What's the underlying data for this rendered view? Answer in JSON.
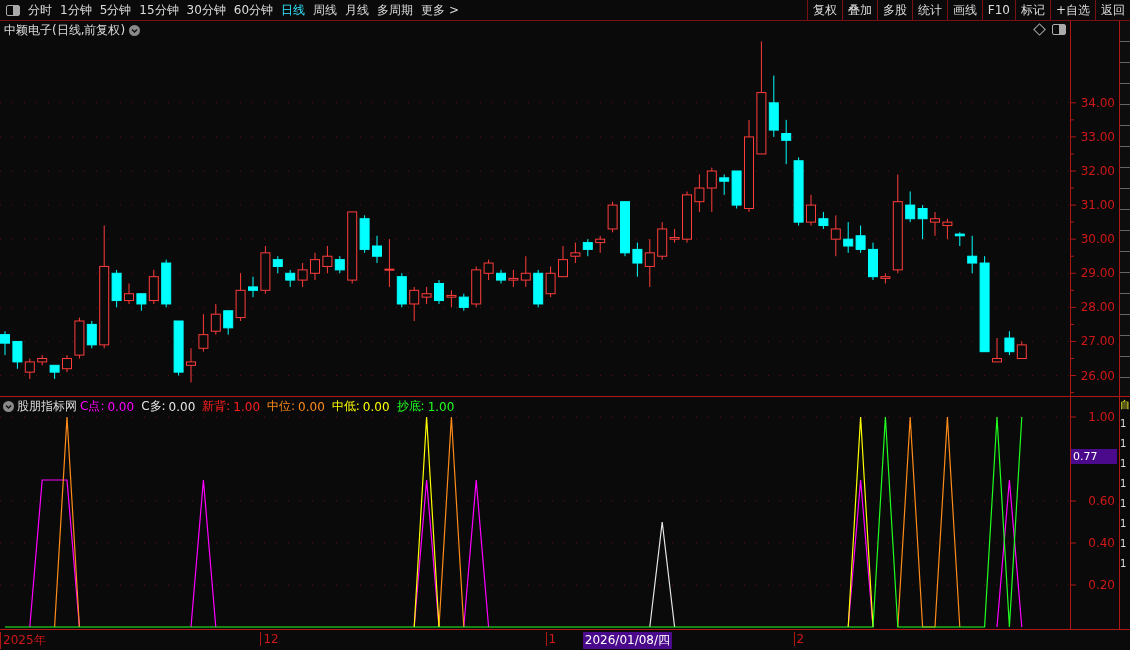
{
  "toolbar": {
    "periods": [
      {
        "label": "分时",
        "selected": false
      },
      {
        "label": "1分钟",
        "selected": false
      },
      {
        "label": "5分钟",
        "selected": false
      },
      {
        "label": "15分钟",
        "selected": false
      },
      {
        "label": "30分钟",
        "selected": false
      },
      {
        "label": "60分钟",
        "selected": false
      },
      {
        "label": "日线",
        "selected": true
      },
      {
        "label": "周线",
        "selected": false
      },
      {
        "label": "月线",
        "selected": false
      },
      {
        "label": "多周期",
        "selected": false
      },
      {
        "label": "更多 >",
        "selected": false
      }
    ],
    "buttons": [
      "复权",
      "叠加",
      "多股",
      "统计",
      "画线",
      "F10",
      "标记",
      "+自选",
      "返回"
    ]
  },
  "price_pane": {
    "title": "中颖电子(日线,前复权)",
    "chart_data": {
      "type": "candlestick",
      "ylim": [
        25.4,
        36.4
      ],
      "grid": true,
      "yticks": [
        {
          "value": 34,
          "label": "34.00"
        },
        {
          "value": 33,
          "label": "33.00"
        },
        {
          "value": 32,
          "label": "32.00"
        },
        {
          "value": 31,
          "label": "31.00"
        },
        {
          "value": 30,
          "label": "30.00"
        },
        {
          "value": 29,
          "label": "29.00"
        },
        {
          "value": 28,
          "label": "28.00"
        },
        {
          "value": 27,
          "label": "27.00"
        },
        {
          "value": 26,
          "label": "26.00"
        }
      ],
      "ohlc": [
        [
          27.2,
          27.3,
          26.6,
          26.95
        ],
        [
          27.0,
          27.0,
          26.2,
          26.4
        ],
        [
          26.1,
          26.5,
          25.9,
          26.4
        ],
        [
          26.4,
          26.6,
          26.3,
          26.5
        ],
        [
          26.3,
          26.3,
          25.9,
          26.1
        ],
        [
          26.2,
          26.6,
          26.1,
          26.5
        ],
        [
          26.6,
          27.7,
          26.5,
          27.6
        ],
        [
          27.5,
          27.6,
          26.8,
          26.9
        ],
        [
          26.9,
          30.4,
          26.8,
          29.2
        ],
        [
          29.0,
          29.1,
          28.0,
          28.2
        ],
        [
          28.2,
          28.7,
          28.1,
          28.4
        ],
        [
          28.4,
          28.4,
          27.9,
          28.1
        ],
        [
          28.2,
          29.1,
          28.1,
          28.9
        ],
        [
          29.3,
          29.4,
          28.0,
          28.1
        ],
        [
          27.6,
          27.6,
          26.0,
          26.1
        ],
        [
          26.3,
          26.8,
          25.8,
          26.4
        ],
        [
          26.8,
          27.8,
          26.7,
          27.2
        ],
        [
          27.3,
          28.1,
          27.2,
          27.8
        ],
        [
          27.9,
          27.9,
          27.2,
          27.4
        ],
        [
          27.7,
          29.0,
          27.6,
          28.5
        ],
        [
          28.6,
          28.9,
          28.3,
          28.5
        ],
        [
          28.5,
          29.8,
          28.4,
          29.6
        ],
        [
          29.4,
          29.5,
          29.0,
          29.2
        ],
        [
          29.0,
          29.1,
          28.6,
          28.8
        ],
        [
          28.8,
          29.3,
          28.6,
          29.1
        ],
        [
          29.0,
          29.6,
          28.8,
          29.4
        ],
        [
          29.2,
          29.8,
          29.0,
          29.5
        ],
        [
          29.4,
          29.5,
          29.0,
          29.1
        ],
        [
          28.8,
          30.8,
          28.7,
          30.8
        ],
        [
          30.6,
          30.7,
          29.6,
          29.7
        ],
        [
          29.8,
          30.1,
          29.3,
          29.5
        ],
        [
          29.1,
          30.0,
          28.6,
          29.12
        ],
        [
          28.9,
          29.0,
          28.0,
          28.1
        ],
        [
          28.1,
          28.6,
          27.6,
          28.5
        ],
        [
          28.3,
          28.6,
          28.1,
          28.4
        ],
        [
          28.7,
          28.8,
          28.1,
          28.2
        ],
        [
          28.3,
          28.5,
          28.0,
          28.35
        ],
        [
          28.3,
          28.4,
          27.9,
          28.0
        ],
        [
          28.1,
          29.2,
          28.0,
          29.1
        ],
        [
          29.0,
          29.4,
          28.8,
          29.3
        ],
        [
          29.0,
          29.1,
          28.7,
          28.8
        ],
        [
          28.8,
          29.1,
          28.6,
          28.85
        ],
        [
          28.8,
          29.5,
          28.6,
          29.0
        ],
        [
          29.0,
          29.1,
          28.0,
          28.1
        ],
        [
          28.4,
          29.2,
          28.3,
          29.0
        ],
        [
          28.9,
          29.8,
          28.9,
          29.4
        ],
        [
          29.5,
          29.9,
          29.3,
          29.6
        ],
        [
          29.9,
          30.0,
          29.5,
          29.7
        ],
        [
          29.9,
          30.1,
          29.6,
          30.0
        ],
        [
          30.3,
          31.1,
          30.2,
          31.0
        ],
        [
          31.1,
          31.1,
          29.5,
          29.6
        ],
        [
          29.7,
          29.9,
          28.9,
          29.3
        ],
        [
          29.2,
          30.0,
          28.6,
          29.6
        ],
        [
          29.5,
          30.5,
          29.4,
          30.3
        ],
        [
          30.0,
          30.3,
          29.9,
          30.05
        ],
        [
          30.0,
          31.4,
          29.9,
          31.3
        ],
        [
          31.1,
          31.9,
          30.8,
          31.5
        ],
        [
          31.5,
          32.1,
          30.8,
          32.0
        ],
        [
          31.8,
          31.9,
          31.3,
          31.7
        ],
        [
          32.0,
          32.0,
          30.9,
          31.0
        ],
        [
          30.9,
          33.5,
          30.8,
          33.0
        ],
        [
          32.5,
          35.8,
          32.5,
          34.3
        ],
        [
          34.0,
          34.8,
          33.0,
          33.2
        ],
        [
          33.1,
          33.5,
          32.2,
          32.9
        ],
        [
          32.3,
          32.4,
          30.4,
          30.5
        ],
        [
          30.5,
          31.3,
          30.4,
          31.0
        ],
        [
          30.6,
          30.8,
          30.3,
          30.4
        ],
        [
          30.0,
          30.7,
          29.5,
          30.3
        ],
        [
          30.0,
          30.5,
          29.6,
          29.8
        ],
        [
          30.1,
          30.4,
          29.6,
          29.7
        ],
        [
          29.7,
          29.9,
          28.8,
          28.9
        ],
        [
          28.85,
          29.0,
          28.7,
          28.9
        ],
        [
          29.1,
          31.9,
          29.0,
          31.1
        ],
        [
          31.0,
          31.4,
          30.5,
          30.6
        ],
        [
          30.9,
          31.0,
          30.0,
          30.6
        ],
        [
          30.5,
          30.8,
          30.1,
          30.6
        ],
        [
          30.4,
          30.6,
          30.0,
          30.5
        ],
        [
          30.15,
          30.2,
          29.8,
          30.1
        ],
        [
          29.5,
          30.1,
          29.0,
          29.3
        ],
        [
          29.3,
          29.5,
          26.7,
          26.7
        ],
        [
          26.4,
          27.1,
          26.4,
          26.5
        ],
        [
          27.1,
          27.3,
          26.6,
          26.7
        ],
        [
          26.5,
          27.0,
          26.5,
          26.9
        ]
      ]
    }
  },
  "indicator": {
    "name": "股朋指标网",
    "legend_values": [
      "0.00",
      "0.00",
      "1.00",
      "0.00",
      "0.00",
      "1.00"
    ],
    "crosshair_value": "0.77",
    "side_label": "自",
    "side_values": [
      "1",
      "1",
      "1",
      "1",
      "1",
      "1",
      "1",
      "1"
    ],
    "chart_data": {
      "type": "line",
      "ylim": [
        0,
        1
      ],
      "grid": true,
      "yticks": [
        {
          "value": 1,
          "label": "1.00"
        },
        {
          "value": 0.6,
          "label": "0.60"
        },
        {
          "value": 0.4,
          "label": "0.40"
        },
        {
          "value": 0.2,
          "label": "0.20"
        }
      ],
      "series": [
        {
          "name": "C点:",
          "color": "#ff00ff",
          "values": [
            null,
            null,
            0,
            0.7,
            0.7,
            0.7,
            0,
            null,
            null,
            null,
            null,
            null,
            null,
            null,
            null,
            0,
            0.7,
            0,
            null,
            null,
            null,
            null,
            null,
            null,
            null,
            null,
            null,
            null,
            null,
            null,
            null,
            null,
            null,
            0,
            0.7,
            0,
            null,
            0,
            0.7,
            0,
            null,
            null,
            null,
            null,
            null,
            null,
            null,
            null,
            null,
            null,
            null,
            null,
            null,
            null,
            null,
            null,
            null,
            null,
            null,
            null,
            null,
            null,
            null,
            null,
            null,
            null,
            null,
            null,
            0,
            0.7,
            0,
            null,
            null,
            null,
            null,
            null,
            null,
            null,
            null,
            null,
            0,
            0.7,
            0
          ]
        },
        {
          "name": "C多:",
          "color": "#e6e6e6",
          "values": [
            null,
            null,
            null,
            null,
            null,
            null,
            null,
            null,
            null,
            null,
            null,
            null,
            null,
            null,
            null,
            null,
            null,
            null,
            null,
            null,
            null,
            null,
            null,
            null,
            null,
            null,
            null,
            null,
            null,
            null,
            null,
            null,
            null,
            null,
            null,
            null,
            null,
            null,
            null,
            null,
            null,
            null,
            null,
            null,
            null,
            null,
            null,
            null,
            null,
            null,
            null,
            null,
            0,
            0.5,
            0,
            null,
            null,
            null,
            null,
            null,
            null,
            null,
            null,
            null,
            null,
            null,
            null,
            null,
            null,
            null,
            null,
            null,
            null,
            null,
            null,
            null,
            null,
            null,
            null,
            null,
            null,
            null,
            null
          ]
        },
        {
          "name": "新背:",
          "color": "#ff2020",
          "values": [
            null,
            null,
            null,
            null,
            null,
            null,
            null,
            null,
            null,
            null,
            null,
            null,
            null,
            null,
            null,
            null,
            null,
            null,
            null,
            null,
            null,
            null,
            null,
            null,
            null,
            null,
            null,
            null,
            null,
            null,
            null,
            null,
            null,
            null,
            null,
            null,
            null,
            null,
            null,
            null,
            null,
            null,
            null,
            null,
            null,
            null,
            null,
            null,
            null,
            null,
            null,
            null,
            null,
            null,
            null,
            null,
            null,
            null,
            null,
            null,
            null,
            null,
            null,
            null,
            null,
            null,
            null,
            null,
            null,
            null,
            null,
            null,
            null,
            null,
            null,
            null,
            null,
            null,
            null,
            null,
            null,
            null,
            null
          ]
        },
        {
          "name": "中位:",
          "color": "#ff8c1a",
          "values": [
            null,
            null,
            null,
            null,
            0,
            1,
            0,
            null,
            null,
            null,
            null,
            null,
            null,
            null,
            null,
            null,
            null,
            null,
            null,
            null,
            null,
            null,
            null,
            null,
            null,
            null,
            null,
            null,
            null,
            null,
            null,
            null,
            null,
            null,
            null,
            0,
            1,
            0,
            null,
            null,
            null,
            null,
            null,
            null,
            null,
            null,
            null,
            null,
            null,
            null,
            null,
            null,
            null,
            null,
            null,
            null,
            null,
            null,
            null,
            null,
            null,
            null,
            null,
            null,
            null,
            null,
            null,
            null,
            null,
            null,
            null,
            null,
            0,
            1,
            0,
            0,
            1,
            0,
            null,
            null,
            null,
            null,
            null
          ]
        },
        {
          "name": "中低:",
          "color": "#ffff00",
          "values": [
            null,
            null,
            null,
            null,
            null,
            null,
            null,
            null,
            null,
            null,
            null,
            null,
            null,
            null,
            null,
            null,
            null,
            null,
            null,
            null,
            null,
            null,
            null,
            null,
            null,
            null,
            null,
            null,
            null,
            null,
            null,
            null,
            null,
            0,
            1,
            0,
            null,
            null,
            null,
            null,
            null,
            null,
            null,
            null,
            null,
            null,
            null,
            null,
            null,
            null,
            null,
            null,
            null,
            null,
            null,
            null,
            null,
            null,
            null,
            null,
            null,
            null,
            null,
            null,
            null,
            null,
            null,
            null,
            0,
            1,
            0,
            null,
            null,
            null,
            null,
            null,
            null,
            null,
            null,
            null,
            null,
            null,
            null
          ]
        },
        {
          "name": "抄底:",
          "color": "#20ff20",
          "values": [
            0,
            0,
            0,
            0,
            0,
            0,
            0,
            0,
            0,
            0,
            0,
            0,
            0,
            0,
            0,
            0,
            0,
            0,
            0,
            0,
            0,
            0,
            0,
            0,
            0,
            0,
            0,
            0,
            0,
            0,
            0,
            0,
            0,
            0,
            0,
            0,
            0,
            0,
            0,
            0,
            0,
            0,
            0,
            0,
            0,
            0,
            0,
            0,
            0,
            0,
            0,
            0,
            0,
            0,
            0,
            0,
            0,
            0,
            0,
            0,
            0,
            0,
            0,
            0,
            0,
            0,
            0,
            0,
            0,
            0,
            0,
            1,
            0,
            0,
            0,
            0,
            0,
            0,
            0,
            0,
            1,
            0,
            1
          ]
        }
      ]
    }
  },
  "date_axis": [
    {
      "text": "2025年",
      "kind": "month"
    },
    {
      "text": "12",
      "kind": "month"
    },
    {
      "text": "1",
      "kind": "month"
    },
    {
      "text": "2026/01/08/四",
      "kind": "cursor"
    },
    {
      "text": "2",
      "kind": "month"
    }
  ]
}
